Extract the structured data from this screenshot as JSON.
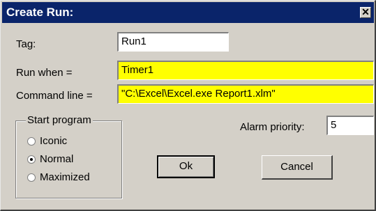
{
  "window": {
    "title": "Create Run:",
    "close_glyph": "✕"
  },
  "form": {
    "tag_label": "Tag:",
    "tag_value": "Run1",
    "run_when_label": "Run when =",
    "run_when_value": "Timer1",
    "command_label": "Command line =",
    "command_value": "\"C:\\Excel\\Excel.exe Report1.xlm\"",
    "alarm_label": "Alarm priority:",
    "alarm_value": "5"
  },
  "start_program": {
    "title": "Start program",
    "options": [
      {
        "label": "Iconic",
        "selected": false
      },
      {
        "label": "Normal",
        "selected": true
      },
      {
        "label": "Maximized",
        "selected": false
      }
    ]
  },
  "buttons": {
    "ok": "Ok",
    "cancel": "Cancel"
  },
  "colors": {
    "titlebar": "#0a246a",
    "dialog": "#d4d0c8",
    "highlight_field": "#ffff00"
  }
}
